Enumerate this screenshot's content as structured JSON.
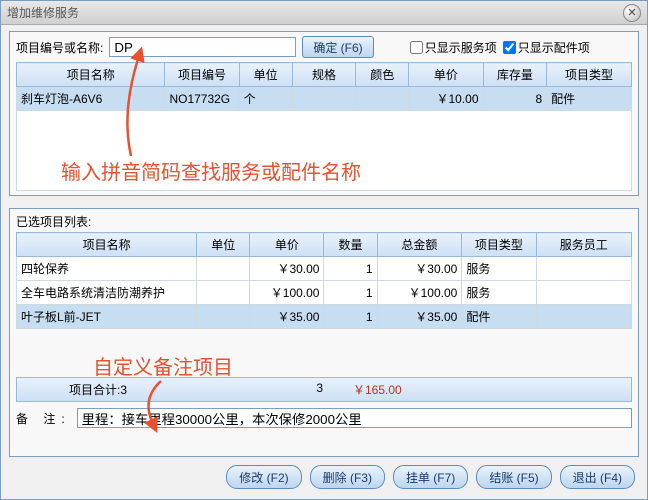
{
  "window": {
    "title": "增加维修服务"
  },
  "search": {
    "label": "项目编号或名称:",
    "value": "DP",
    "confirm": "确定 (F6)",
    "only_service": "只显示服务项",
    "only_part": "只显示配件项"
  },
  "top_table": {
    "headers": [
      "项目名称",
      "项目编号",
      "单位",
      "规格",
      "颜色",
      "单价",
      "库存量",
      "项目类型"
    ],
    "rows": [
      {
        "name": "刹车灯泡-A6V6",
        "code": "NO17732G",
        "unit": "个",
        "spec": "",
        "color": "",
        "price": "￥10.00",
        "stock": "8",
        "type": "配件"
      }
    ]
  },
  "annotation1": "输入拼音简码查找服务或配件名称",
  "annotation2": "自定义备注项目",
  "selected_label": "已选项目列表:",
  "sel_table": {
    "headers": [
      "项目名称",
      "单位",
      "单价",
      "数量",
      "总金额",
      "项目类型",
      "服务员工"
    ],
    "rows": [
      {
        "name": "四轮保养",
        "unit": "",
        "price": "￥30.00",
        "qty": "1",
        "amount": "￥30.00",
        "type": "服务",
        "staff": ""
      },
      {
        "name": "全车电路系统清洁防潮养护",
        "unit": "",
        "price": "￥100.00",
        "qty": "1",
        "amount": "￥100.00",
        "type": "服务",
        "staff": ""
      },
      {
        "name": "叶子板L前-JET",
        "unit": "",
        "price": "￥35.00",
        "qty": "1",
        "amount": "￥35.00",
        "type": "配件",
        "staff": ""
      }
    ]
  },
  "totals": {
    "label": "项目合计:3",
    "qty": "3",
    "amount": "￥165.00"
  },
  "remark": {
    "label": "备 注:",
    "value": "里程：接车里程30000公里，本次保修2000公里"
  },
  "buttons": {
    "edit": "修改 (F2)",
    "delete": "删除 (F3)",
    "hold": "挂单 (F7)",
    "checkout": "结账 (F5)",
    "exit": "退出 (F4)"
  }
}
